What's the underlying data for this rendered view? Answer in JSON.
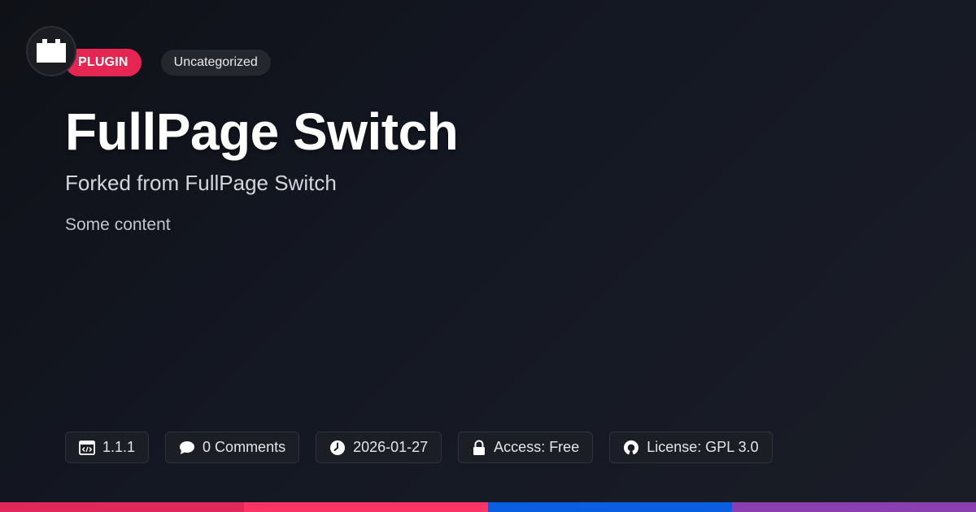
{
  "header": {
    "type_tag": "PLUGIN",
    "category_tag": "Uncategorized"
  },
  "main": {
    "title": "FullPage Switch",
    "subtitle": "Forked from FullPage Switch",
    "content": "Some content"
  },
  "meta": {
    "version": {
      "icon": "code-window-icon",
      "label": "1.1.1"
    },
    "comments": {
      "icon": "speech-bubble-icon",
      "label": "0 Comments"
    },
    "date": {
      "icon": "clock-icon",
      "label": "2026-01-27"
    },
    "access": {
      "icon": "lock-icon",
      "label": "Access: Free"
    },
    "license": {
      "icon": "open-source-icon",
      "label": "License: GPL 3.0"
    }
  },
  "colors": {
    "background": "#12151c",
    "plugin_tag": "#e52653",
    "bar_segments": [
      "#e0285a",
      "#fa3566",
      "#0a5fe0",
      "#8a3fb0"
    ]
  }
}
